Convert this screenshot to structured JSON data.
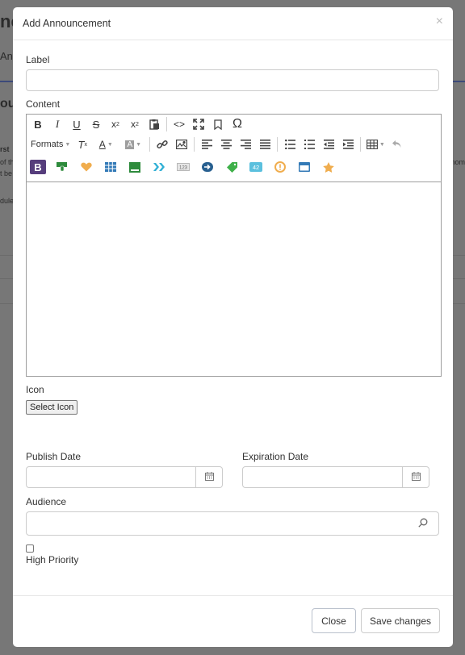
{
  "background": {
    "title_fragment": "ne",
    "tab_fragment": "Ann",
    "heading_fragment": "ou",
    "text1": "rst",
    "text2": "of th",
    "text3": "t be",
    "text4": "dule",
    "text5": "nom"
  },
  "modal": {
    "title": "Add Announcement",
    "close_glyph": "×"
  },
  "form": {
    "label_label": "Label",
    "label_value": "",
    "content_label": "Content",
    "icon_label": "Icon",
    "select_icon_button": "Select Icon",
    "publish_date_label": "Publish Date",
    "publish_date_value": "",
    "expiration_date_label": "Expiration Date",
    "expiration_date_value": "",
    "audience_label": "Audience",
    "audience_value": "",
    "high_priority_label": "High Priority",
    "high_priority_checked": false
  },
  "toolbar": {
    "formats_label": "Formats",
    "row1": [
      "bold-icon",
      "italic-icon",
      "underline-icon",
      "strikethrough-icon",
      "superscript-icon",
      "subscript-icon",
      "paste-icon",
      "code-icon",
      "fullscreen-icon",
      "bookmark-icon",
      "omega-icon"
    ],
    "row3_icons": [
      "bootstrap-icon",
      "green-badge-icon",
      "heart-icon",
      "table-grid-icon",
      "green-panel-icon",
      "double-chevron-icon",
      "number-input-icon",
      "arrow-circle-icon",
      "tag-icon",
      "badge-42-icon",
      "alert-circle-icon",
      "window-icon",
      "star-icon"
    ],
    "badge_text": "42",
    "number_text": "123"
  },
  "footer": {
    "close_button": "Close",
    "save_button": "Save changes"
  },
  "colors": {
    "overlay": "#777777",
    "bootstrap_purple": "#563d7c",
    "accent_blue": "#337ab7",
    "orange": "#f0ad4e",
    "green": "#2e8b3c"
  }
}
